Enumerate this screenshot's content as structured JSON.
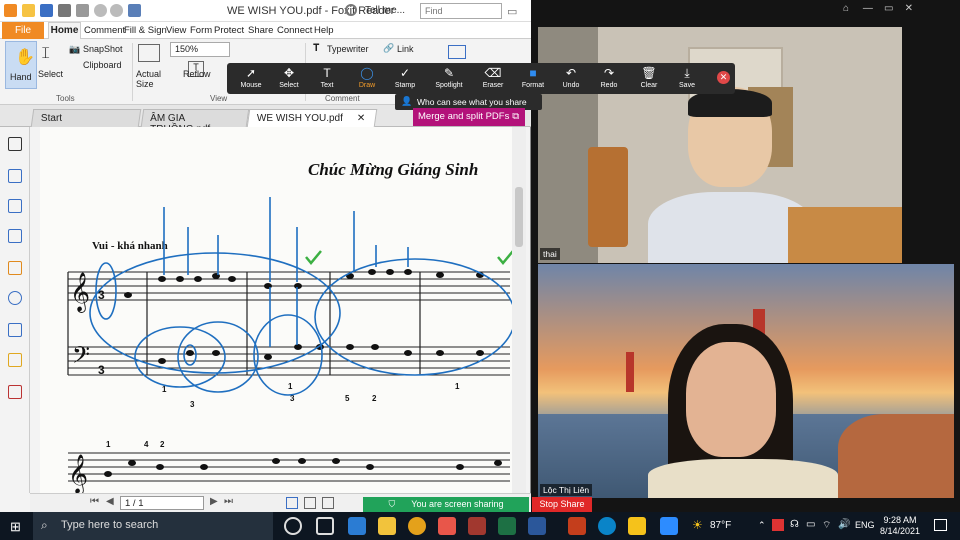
{
  "foxit": {
    "doc_title": "WE WISH YOU.pdf - Foxit Reader",
    "tell_me": "Tell me...",
    "find_placeholder": "Find",
    "menus": [
      "File",
      "Home",
      "Comment",
      "Fill & Sign",
      "View",
      "Form",
      "Protect",
      "Share",
      "Connect",
      "Help"
    ],
    "ribbon": {
      "hand": "Hand",
      "select": "Select",
      "snapshot": "SnapShot",
      "clipboard": "Clipboard",
      "actual_size": "Actual Size",
      "zoom": "150%",
      "reflow": "Reflow",
      "typewriter": "Typewriter",
      "link": "Link",
      "groups": {
        "tools": "Tools",
        "view": "View",
        "comment": "Comment"
      }
    },
    "tabs": [
      "Start",
      "ÂM GIA TRUỒNG.pdf",
      "WE WISH YOU.pdf"
    ],
    "page_nav": "1 / 1",
    "sheet": {
      "title": "Chúc Mừng Giáng Sinh",
      "tempo": "Vui - khá nhanh",
      "time_sig": "3/4",
      "fingering": [
        "1",
        "3",
        "1",
        "3",
        "5",
        "2",
        "1",
        "1",
        "4",
        "2"
      ]
    }
  },
  "zoom_toolbar": {
    "tools": [
      {
        "label": "Mouse",
        "icon": "cursor-icon"
      },
      {
        "label": "Select",
        "icon": "move-icon"
      },
      {
        "label": "Text",
        "icon": "text-icon"
      },
      {
        "label": "Draw",
        "icon": "draw-icon"
      },
      {
        "label": "Stamp",
        "icon": "check-icon"
      },
      {
        "label": "Spotlight",
        "icon": "spotlight-icon"
      },
      {
        "label": "Eraser",
        "icon": "eraser-icon"
      },
      {
        "label": "Format",
        "icon": "format-icon"
      },
      {
        "label": "Undo",
        "icon": "undo-icon"
      },
      {
        "label": "Redo",
        "icon": "redo-icon"
      },
      {
        "label": "Clear",
        "icon": "trash-icon"
      },
      {
        "label": "Save",
        "icon": "save-icon"
      }
    ],
    "who_can_see": "Who can see what you share here?",
    "merge_banner": "Merge and split PDFs"
  },
  "zoom": {
    "participant1": "thai",
    "participant2": "Lộc Thị Liên",
    "sharing": "You are screen sharing",
    "stop_share": "Stop Share"
  },
  "taskbar": {
    "search_placeholder": "Type here to search",
    "weather": "87°F",
    "language": "ENG",
    "time": "9:28 AM",
    "date": "8/14/2021"
  }
}
